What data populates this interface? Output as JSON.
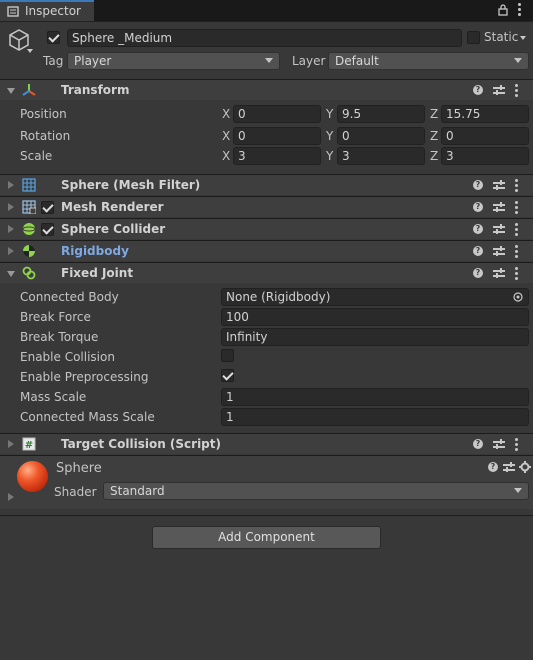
{
  "window": {
    "tab_title": "Inspector"
  },
  "header": {
    "object_name": "Sphere _Medium",
    "static_label": "Static",
    "tag_label": "Tag",
    "tag_value": "Player",
    "layer_label": "Layer",
    "layer_value": "Default",
    "active": true
  },
  "transform": {
    "title": "Transform",
    "rows": [
      {
        "label": "Position",
        "x": "0",
        "y": "9.5",
        "z": "15.75"
      },
      {
        "label": "Rotation",
        "x": "0",
        "y": "0",
        "z": "0"
      },
      {
        "label": "Scale",
        "x": "3",
        "y": "3",
        "z": "3"
      }
    ],
    "axis": {
      "x": "X",
      "y": "Y",
      "z": "Z"
    }
  },
  "components": {
    "mesh_filter": "Sphere (Mesh Filter)",
    "mesh_renderer": "Mesh Renderer",
    "sphere_collider": "Sphere Collider",
    "rigidbody": "Rigidbody",
    "fixed_joint": "Fixed Joint",
    "target_collision": "Target Collision (Script)"
  },
  "fixed_joint": {
    "connected_body_label": "Connected Body",
    "connected_body_value": "None (Rigidbody)",
    "break_force_label": "Break Force",
    "break_force_value": "100",
    "break_torque_label": "Break Torque",
    "break_torque_value": "Infinity",
    "enable_collision_label": "Enable Collision",
    "enable_collision_checked": false,
    "enable_preprocessing_label": "Enable Preprocessing",
    "enable_preprocessing_checked": true,
    "mass_scale_label": "Mass Scale",
    "mass_scale_value": "1",
    "connected_mass_scale_label": "Connected Mass Scale",
    "connected_mass_scale_value": "1"
  },
  "material": {
    "name": "Sphere",
    "shader_label": "Shader",
    "shader_value": "Standard",
    "color": "#e8401c"
  },
  "add_component_label": "Add Component",
  "colors": {
    "accent": "#3a79bb",
    "rigidbody_title": "#7fa8e0"
  }
}
